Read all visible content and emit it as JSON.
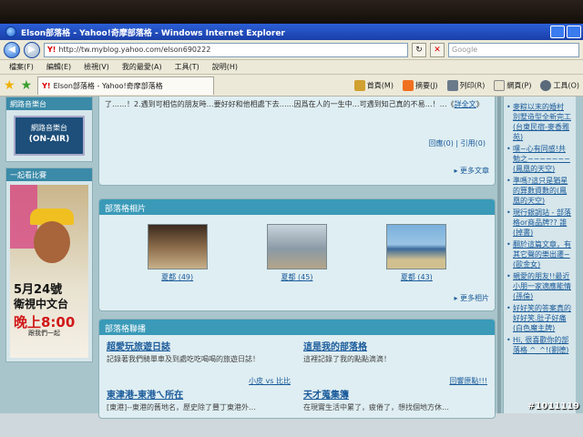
{
  "window": {
    "title": "Elson部落格 - Yahoo!奇摩部落格 - Windows Internet Explorer"
  },
  "address": {
    "url": "http://tw.myblog.yahoo.com/elson690222",
    "search_placeholder": "Google"
  },
  "menu": {
    "items": [
      "檔案(F)",
      "編輯(E)",
      "檢視(V)",
      "我的最愛(A)",
      "工具(T)",
      "說明(H)"
    ]
  },
  "tab": {
    "label": "Elson部落格 - Yahoo!奇摩部落格"
  },
  "commands": {
    "home": "首頁(M)",
    "feeds": "摘要(J)",
    "print": "列印(R)",
    "page": "網頁(P)",
    "tools": "工具(O)"
  },
  "left": {
    "header1": "網路音樂台",
    "radio_line1": "網路音樂台",
    "radio_line2": "(ON-AIR)",
    "header2": "一起看比賽",
    "poster": {
      "date": "5月24號",
      "channel": "衛視中文台",
      "time": "晚上8:00",
      "sub": "跟我們一起"
    }
  },
  "article": {
    "text": "了……！2.遇到可相信的朋友時…要好好和他相處下去……因爲在人的一生中…可遇到知己真的不易…！…《",
    "full_link": "詳全文",
    "close": "》",
    "replies": "回應(0)",
    "trackback": "引用(0)",
    "more": "更多文章"
  },
  "photos": {
    "header": "部落格相片",
    "items": [
      {
        "caption": "夏都 (49)"
      },
      {
        "caption": "夏都 (45)"
      },
      {
        "caption": "夏都 (43)"
      }
    ],
    "more": "更多相片"
  },
  "blogroll": {
    "header": "部落格聯播",
    "items": [
      {
        "title": "超愛玩旅遊日誌",
        "desc": "記錄著我們騎單車及到處吃吃喝喝的旅遊日誌！",
        "link": "小皮 vs 比比"
      },
      {
        "title": "這是我的部落格",
        "desc": "這裡記錄了我的點點滴滴！",
        "link": "回響原點!!!"
      },
      {
        "title": "東津港-東港ㄟ所在",
        "desc": "[東港]--東港的舊地名，歷史除了豐丁東港外…",
        "link": ""
      },
      {
        "title": "天才蒐集簿",
        "desc": "在現實生活中累了，疲倦了，想找個地方休…",
        "link": ""
      }
    ]
  },
  "right": {
    "items": [
      "麥粽以末的婚村 別墅造型全新完工(台東民宿-麥香雅苑)",
      "嘿~心有同感!共勉之~~~~~~~(鳳凰的天空)",
      "準嗎?這只是猶星的算數資數的(鳳凰的天空)",
      "現行銀調站 - 部落格or商品牌?? 誰(掉書)",
      "翻於這篇文章，有其它聲的樂出遷~(歐金女)",
      "親愛的朋友!!最近小朋一家適應能情(孫倫)",
      "好好笑的答案真的好好笑.肚子好痛(白色魔主牌)",
      "Hi, 很喜歡你的部落格 ^_^!(劉德)"
    ]
  },
  "watermark": "#1011119"
}
